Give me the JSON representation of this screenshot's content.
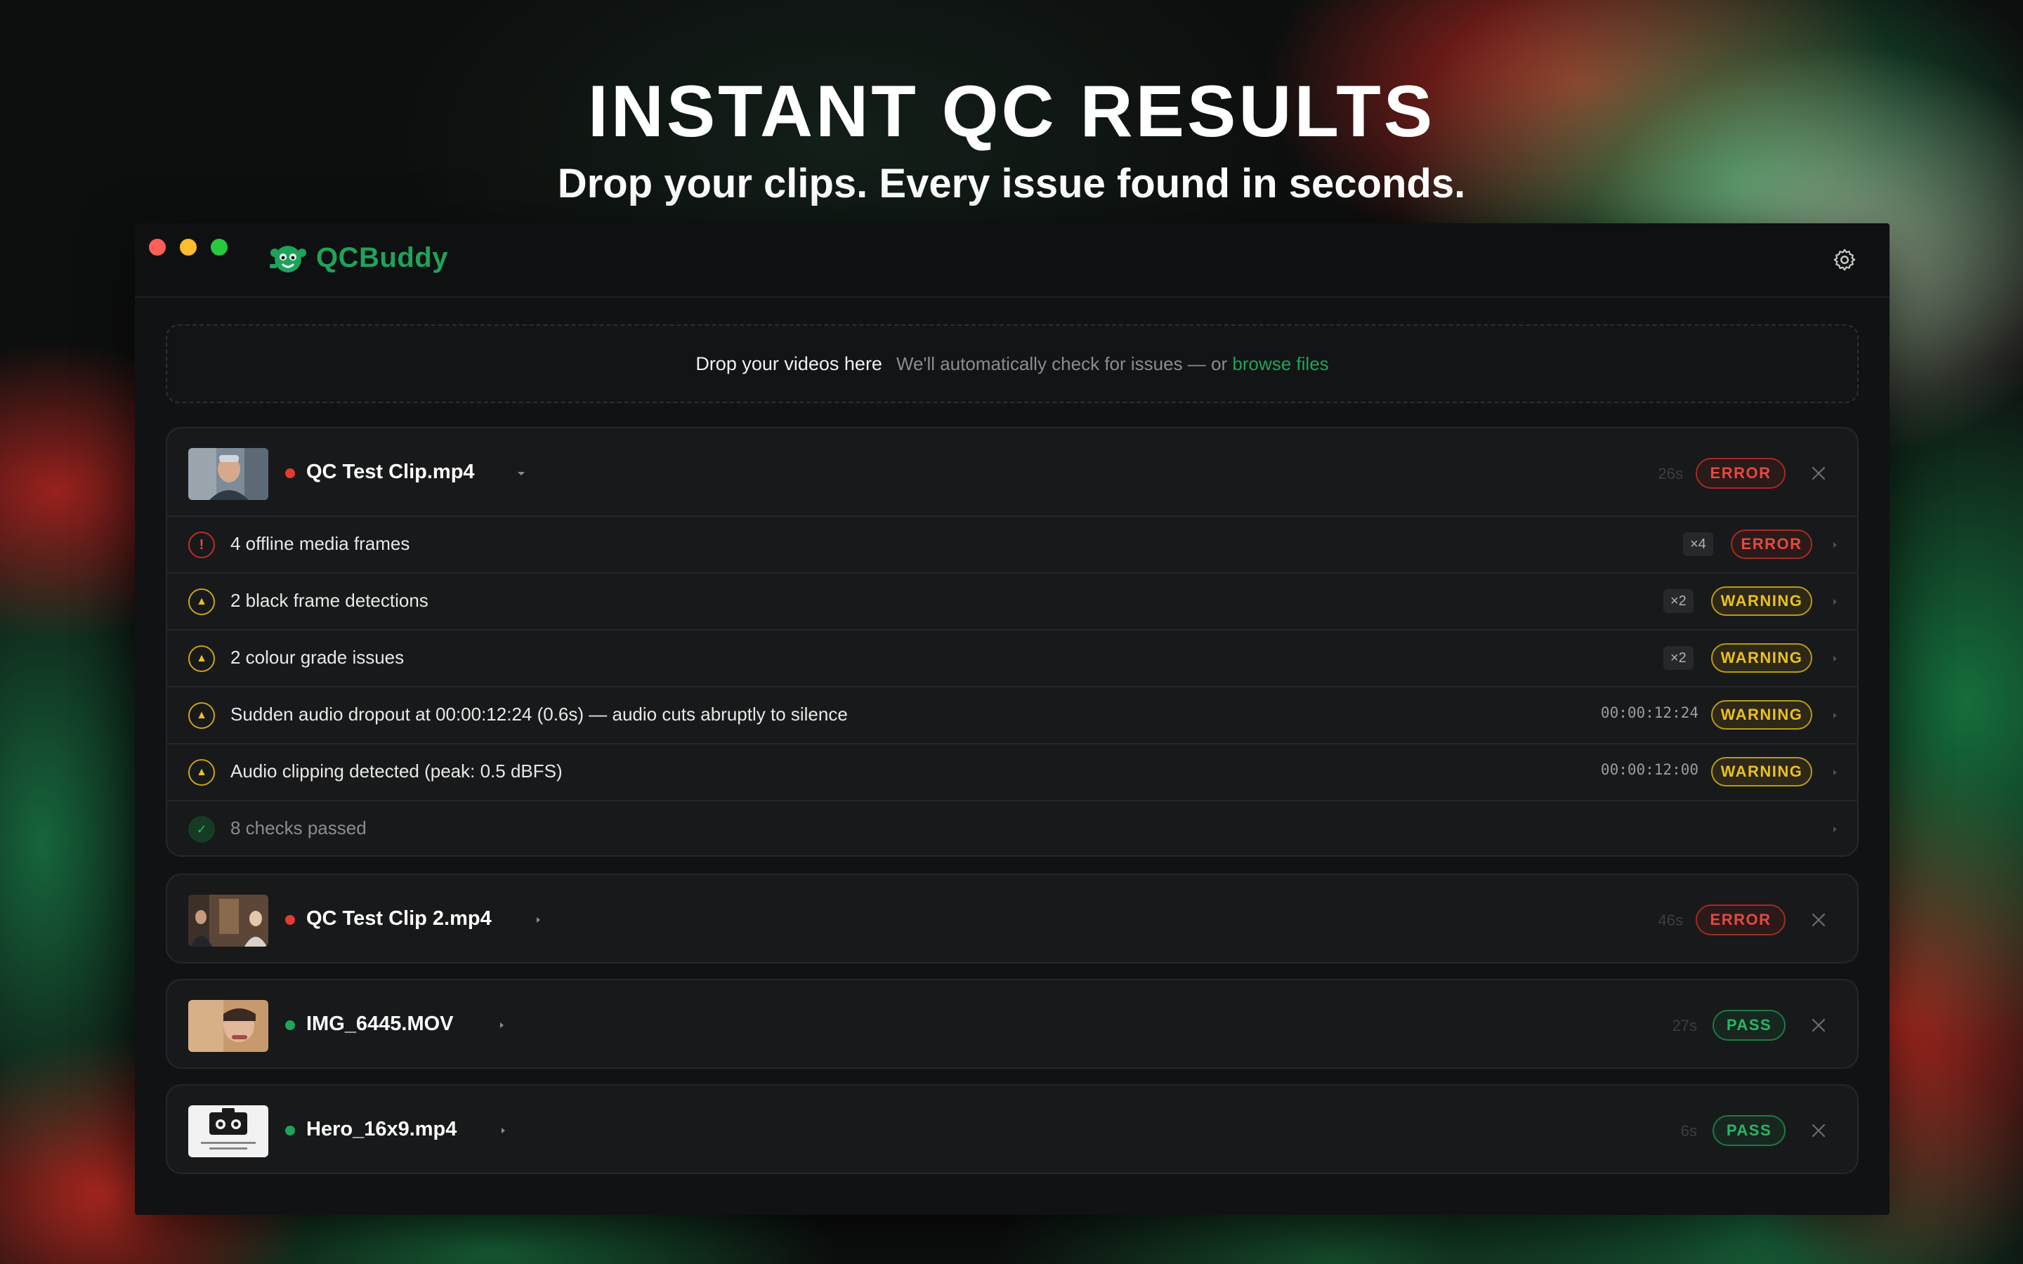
{
  "hero": {
    "title": "INSTANT QC RESULTS",
    "subtitle": "Drop your clips. Every issue found in seconds."
  },
  "app": {
    "name": "QCBuddy",
    "accent_color": "#1ea35b",
    "icons": [
      "qcbuddy-logo",
      "gear-icon"
    ]
  },
  "dropzone": {
    "title": "Drop your videos here",
    "hint": "We'll automatically check for issues — or",
    "link": "browse files"
  },
  "clips": [
    {
      "name": "QC Test Clip.mp4",
      "status_color": "#e23b32",
      "time": "26s",
      "badge": "ERROR",
      "expanded": true,
      "issues": [
        {
          "icon": "error-icon",
          "text": "4 offline media frames",
          "count": "×4",
          "badge": "ERROR"
        },
        {
          "icon": "warning-icon",
          "text": "2 black frame detections",
          "count": "×2",
          "badge": "WARNING"
        },
        {
          "icon": "warning-icon",
          "text": "2 colour grade issues",
          "count": "×2",
          "badge": "WARNING"
        },
        {
          "icon": "warning-icon",
          "text": "Sudden audio dropout at 00:00:12:24 (0.6s) — audio cuts abruptly to silence",
          "timecode": "00:00:12:24",
          "badge": "WARNING"
        },
        {
          "icon": "warning-icon",
          "text": "Audio clipping detected (peak: 0.5 dBFS)",
          "timecode": "00:00:12:00",
          "badge": "WARNING"
        },
        {
          "icon": "check-icon",
          "text": "8 checks passed"
        }
      ]
    },
    {
      "name": "QC Test Clip 2.mp4",
      "status_color": "#e23b32",
      "time": "46s",
      "badge": "ERROR",
      "expanded": false
    },
    {
      "name": "IMG_6445.MOV",
      "status_color": "#1ea35b",
      "time": "27s",
      "badge": "PASS",
      "expanded": false
    },
    {
      "name": "Hero_16x9.mp4",
      "status_color": "#1ea35b",
      "time": "6s",
      "badge": "PASS",
      "expanded": false
    }
  ]
}
